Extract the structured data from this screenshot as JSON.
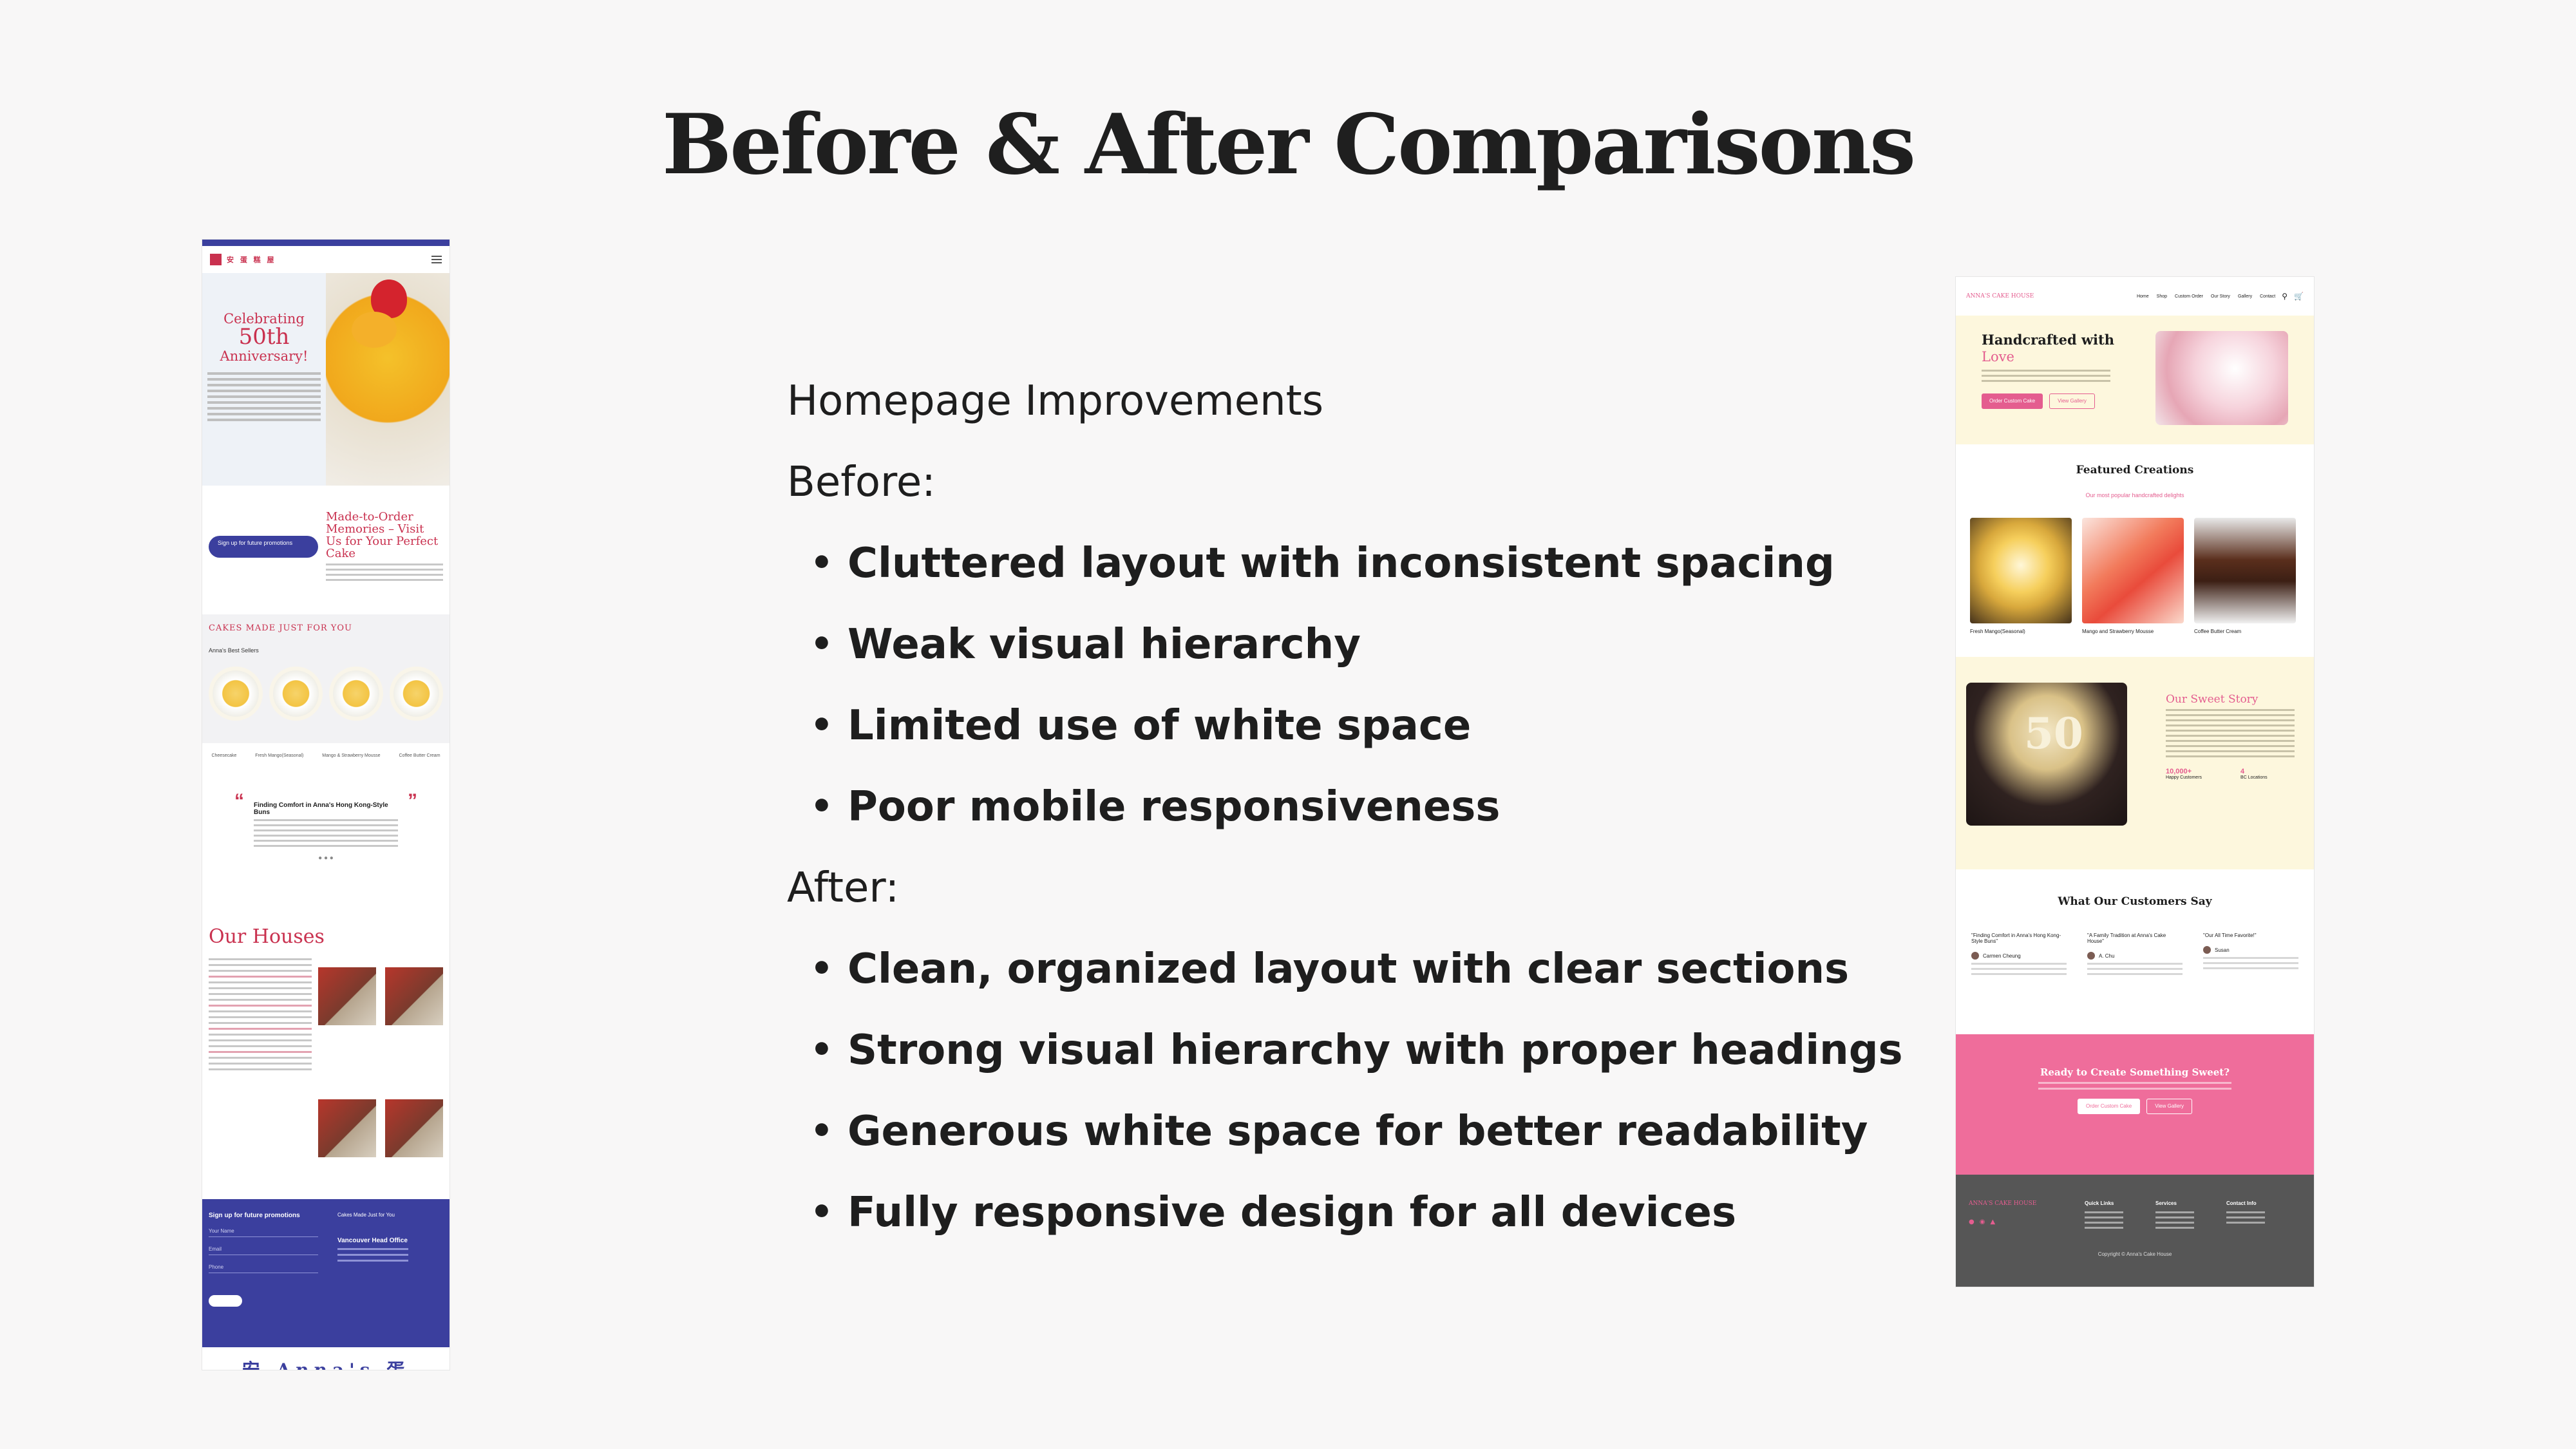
{
  "slide": {
    "title": "Before & After Comparisons"
  },
  "content": {
    "heading": "Homepage Improvements",
    "before_label": "Before:",
    "before_points": [
      "Cluttered layout with inconsistent spacing",
      "Weak visual hierarchy",
      "Limited use of white space",
      "Poor mobile responsiveness"
    ],
    "after_label": "After:",
    "after_points": [
      "Clean, organized layout with clear sections",
      "Strong visual hierarchy with proper headings",
      "Generous white space for better readability",
      "Fully responsive design for all devices"
    ]
  },
  "before_mockup": {
    "celebrate_line1": "Celebrating",
    "celebrate_big": "50th",
    "celebrate_line2": "Anniversary!",
    "promo_pill": "Sign up for future promotions",
    "promo_title": "Made-to-Order Memories – Visit Us for Your Perfect Cake",
    "cakes_title": "CAKES MADE JUST FOR YOU",
    "best_sellers": "Anna's Best Sellers",
    "cake_labels": [
      "Cheesecake",
      "Fresh Mango(Seasonal)",
      "Mango & Strawberry Mousse",
      "Coffee Butter Cream"
    ],
    "testimonial_title": "Finding Comfort in Anna's Hong Kong-Style Buns",
    "houses_title": "Our Houses",
    "footer_title": "Sign up for future promotions",
    "footer_fields": [
      "Your Name",
      "Email",
      "Phone"
    ],
    "footer_office": "Vancouver Head Office",
    "footer_links": "Cakes Made Just for You",
    "bottom_logo": "安 Anna's 蛋 Cake 糕 House 屋"
  },
  "after_mockup": {
    "brand": "ANNA'S CAKE HOUSE",
    "nav_links": [
      "Home",
      "Shop",
      "Custom Order",
      "Our Story",
      "Gallery",
      "Contact"
    ],
    "hero_title": "Handcrafted with",
    "hero_pink": "Love",
    "btn_order": "Order Custom Cake",
    "btn_gallery": "View Gallery",
    "featured_title": "Featured Creations",
    "featured_sub": "Our most popular handcrafted delights",
    "featured_items": [
      "Fresh Mango(Seasonal)",
      "Mango and Strawberry Mousse",
      "Coffee Butter Cream"
    ],
    "story_title": "Our Sweet Story",
    "story_badge": "50",
    "stats": [
      {
        "num": "10,000+",
        "label": "Happy Customers"
      },
      {
        "num": "4",
        "label": "BC Locations"
      }
    ],
    "testimonials_title": "What Our Customers Say",
    "testimonials": [
      {
        "quote": "\"Finding Comfort in Anna's Hong Kong-Style Buns\"",
        "name": "Carmen Cheung"
      },
      {
        "quote": "\"A Family Tradition at Anna's Cake House\"",
        "name": "A. Chu"
      },
      {
        "quote": "\"Our All Time Favorite!\"",
        "name": "Susan"
      }
    ],
    "cta_title": "Ready to Create Something Sweet?",
    "cta_btn_order": "Order Custom Cake",
    "cta_btn_gallery": "View Gallery",
    "footer_brand": "ANNA'S CAKE HOUSE",
    "footer_cols": [
      "Quick Links",
      "Services",
      "Contact Info"
    ],
    "copyright": "Copyright © Anna's Cake House"
  }
}
